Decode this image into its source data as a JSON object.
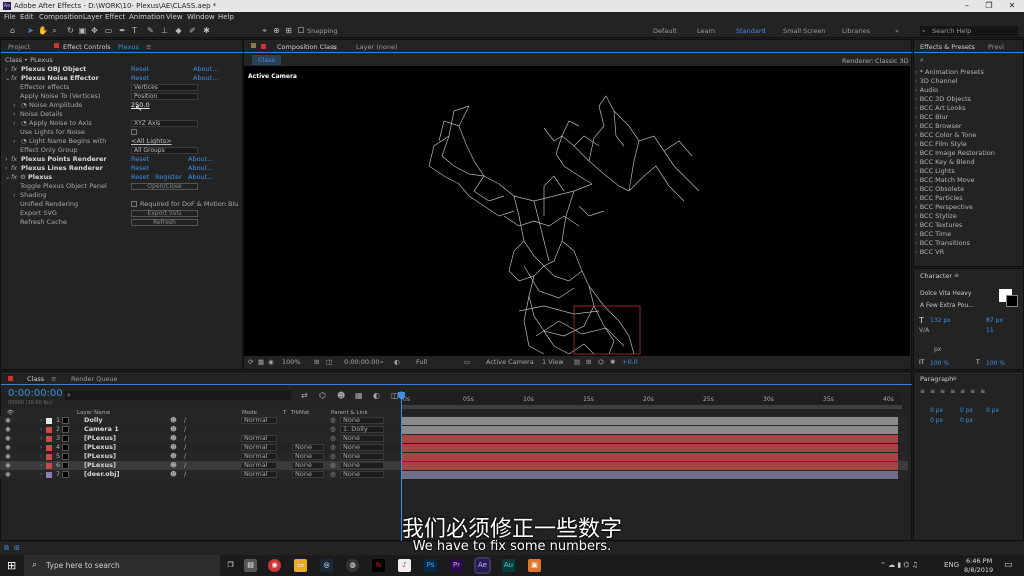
{
  "window": {
    "title": "Adobe After Effects - D:\\WORK\\10- Plexus\\AE\\CLASS.aep *",
    "app_icon": "Ae"
  },
  "menu": [
    "File",
    "Edit",
    "Composition",
    "Layer",
    "Effect",
    "Animation",
    "View",
    "Window",
    "Help"
  ],
  "toolbar": {
    "snapping_label": "Snapping",
    "workspaces": [
      "Default",
      "Learn",
      "Standard",
      "Small Screen",
      "Libraries"
    ],
    "active_workspace": "Standard",
    "search_help": "Search Help"
  },
  "effect_controls": {
    "tabs": [
      "Project",
      "Effect Controls",
      "Plexus"
    ],
    "breadcrumb": "Class • PLexus",
    "rows": [
      {
        "name": "Plexus OBJ Object",
        "type": "header",
        "reset": "Reset",
        "about": "About..."
      },
      {
        "name": "Plexus Noise Effector",
        "type": "header",
        "reset": "Reset",
        "about": "About..."
      },
      {
        "name": "Effector effects",
        "type": "prop",
        "value": "Vertices"
      },
      {
        "name": "Apply Noise To (Vertices)",
        "type": "prop",
        "value": "Position"
      },
      {
        "name": "Noise Amplitude",
        "type": "prop",
        "value": "250.0"
      },
      {
        "name": "Noise Details",
        "type": "prop",
        "value": ""
      },
      {
        "name": "Apply Noise to Axis",
        "type": "prop",
        "value": "XYZ Axis"
      },
      {
        "name": "Use Lights for Noise",
        "type": "prop",
        "value": ""
      },
      {
        "name": "Light Name Begins with",
        "type": "prop",
        "value": "<All Lights>"
      },
      {
        "name": "Effect Only Group",
        "type": "prop",
        "value": "All Groups"
      },
      {
        "name": "Plexus Points Renderer",
        "type": "header",
        "reset": "Reset",
        "about": "About..."
      },
      {
        "name": "Plexus Lines Renderer",
        "type": "header",
        "reset": "Reset",
        "about": "About..."
      },
      {
        "name": "Plexus",
        "type": "header",
        "reset": "Reset",
        "register": "Register",
        "about": "About..."
      },
      {
        "name": "Toggle Plexus Object Panel",
        "type": "prop",
        "value": "Open/Close"
      },
      {
        "name": "Shading",
        "type": "prop",
        "value": ""
      },
      {
        "name": "Unified Rendering",
        "type": "prop",
        "value": "Required for DoF & Motion Blu"
      },
      {
        "name": "Export SVG",
        "type": "prop",
        "value": "Export SVG"
      },
      {
        "name": "Refresh Cache",
        "type": "prop",
        "value": "Refresh"
      }
    ]
  },
  "composition": {
    "tab": "Composition Class",
    "layer_tab": "Layer (none)",
    "comp_name": "Class",
    "renderer_label": "Renderer:",
    "renderer": "Classic 3D",
    "view_label": "Active Camera",
    "footer": {
      "zoom": "100%",
      "time": "0:00:00:00",
      "quality": "Full",
      "camera": "Active Camera",
      "views": "1 View",
      "exposure": "+0.0"
    }
  },
  "effects_presets": {
    "tabs": [
      "Effects & Presets",
      "Previ"
    ],
    "items": [
      "* Animation Presets",
      "3D Channel",
      "Audio",
      "BCC 3D Objects",
      "BCC Art Looks",
      "BCC Blur",
      "BCC Browser",
      "BCC Color & Tone",
      "BCC Film Style",
      "BCC Image Restoration",
      "BCC Key & Blend",
      "BCC Lights",
      "BCC Match Move",
      "BCC Obsolete",
      "BCC Particles",
      "BCC Perspective",
      "BCC Stylize",
      "BCC Textures",
      "BCC Time",
      "BCC Transitions",
      "BCC VR"
    ]
  },
  "character": {
    "title": "Character",
    "font": "Dolce Vita Heavy",
    "style": "A Few Extra Pou...",
    "size": "132 px",
    "leading": "87 px",
    "tracking": "11",
    "scale_v": "100 %",
    "scale_h": "100 %",
    "px": "px"
  },
  "paragraph": {
    "title": "Paragraph",
    "indent_values": [
      "0 px",
      "0 px",
      "0 px",
      "0 px",
      "0 px"
    ]
  },
  "timeline": {
    "tabs": [
      "Class",
      "Render Queue"
    ],
    "timecode": "0:00:00:00",
    "frame_info": "00000 (30.00 fps)",
    "columns": [
      "Layer Name",
      "Mode",
      "T",
      "TrkMat",
      "Parent & Link"
    ],
    "ruler": [
      "0s",
      "05s",
      "10s",
      "15s",
      "20s",
      "25s",
      "30s",
      "35s",
      "40s"
    ],
    "layers": [
      {
        "num": "1",
        "name": "Dolly",
        "mode": "Normal",
        "trkmat": "",
        "parent": "None",
        "color": "#e6e6e6",
        "bar": "#8a8a8a"
      },
      {
        "num": "2",
        "name": "Camera 1",
        "mode": "",
        "trkmat": "",
        "parent": "1. Dolly",
        "color": "#c94b4b",
        "bar": "#8a8a8a"
      },
      {
        "num": "3",
        "name": "[PLexus]",
        "mode": "Normal",
        "trkmat": "",
        "parent": "None",
        "color": "#c94b4b",
        "bar": "#a64545"
      },
      {
        "num": "4",
        "name": "[PLexus]",
        "mode": "Normal",
        "trkmat": "None",
        "parent": "None",
        "color": "#c94b4b",
        "bar": "#a64545"
      },
      {
        "num": "5",
        "name": "[PLexus]",
        "mode": "Normal",
        "trkmat": "None",
        "parent": "None",
        "color": "#c94b4b",
        "bar": "#a64545"
      },
      {
        "num": "6",
        "name": "[PLexus]",
        "mode": "Normal",
        "trkmat": "None",
        "parent": "None",
        "color": "#c94b4b",
        "bar": "#a64545"
      },
      {
        "num": "7",
        "name": "[deer.obj]",
        "mode": "Normal",
        "trkmat": "None",
        "parent": "None",
        "color": "#8c7fb5",
        "bar": "#6f6f8a"
      }
    ]
  },
  "subtitles": {
    "chinese": "我们必须修正一些数字",
    "english": "We have to fix some numbers."
  },
  "taskbar": {
    "search_placeholder": "Type here to search",
    "time": "6:46 PM",
    "date": "8/8/2019",
    "lang": "ENG"
  }
}
